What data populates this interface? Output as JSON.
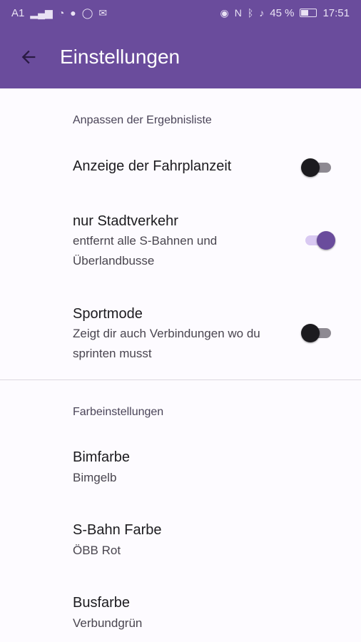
{
  "statusbar": {
    "carrier": "A1",
    "battery_text": "45 %",
    "time": "17:51",
    "battery_level": 0.45
  },
  "appbar": {
    "title": "Einstellungen"
  },
  "sections": {
    "results": {
      "header": "Anpassen der Ergebnisliste",
      "items": [
        {
          "title": "Anzeige der Fahrplanzeit",
          "subtitle": "",
          "enabled": false
        },
        {
          "title": "nur Stadtverkehr",
          "subtitle": "entfernt alle S-Bahnen und Überlandbusse",
          "enabled": true
        },
        {
          "title": "Sportmode",
          "subtitle": "Zeigt dir auch Verbindungen wo du sprinten musst",
          "enabled": false
        }
      ]
    },
    "colors": {
      "header": "Farbeinstellungen",
      "items": [
        {
          "title": "Bimfarbe",
          "subtitle": "Bimgelb"
        },
        {
          "title": "S-Bahn Farbe",
          "subtitle": "ÖBB Rot"
        },
        {
          "title": "Busfarbe",
          "subtitle": "Verbundgrün"
        }
      ]
    }
  },
  "theme": {
    "primary": "#6a4c9c",
    "track_on": "#d9c9f2",
    "background": "#fdfbff"
  }
}
